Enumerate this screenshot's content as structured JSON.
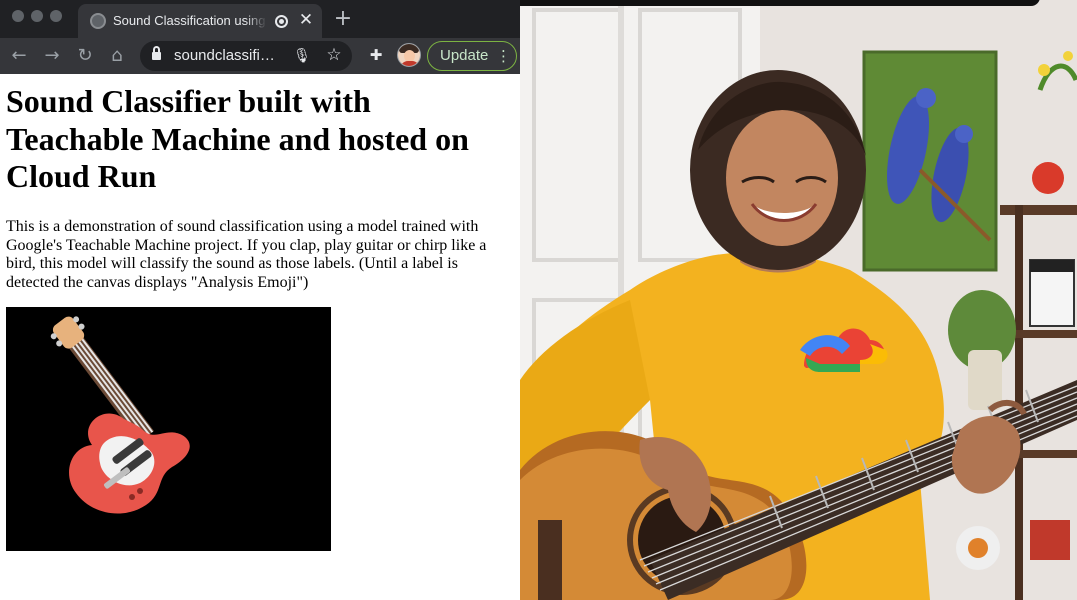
{
  "browser": {
    "tab": {
      "title": "Sound Classification using Teachable Machine",
      "close_icon": "close-icon",
      "recording_icon": "recording-icon"
    },
    "new_tab_icon": "plus-icon",
    "toolbar": {
      "back_icon": "arrow-left-icon",
      "forward_icon": "arrow-right-icon",
      "reload_icon": "reload-icon",
      "home_icon": "home-icon",
      "url": "soundclassifi…",
      "mic_icon": "microphone-icon",
      "bookmark_icon": "star-icon",
      "extensions_icon": "puzzle-icon",
      "update_label": "Update",
      "menu_icon": "kebab-menu-icon"
    }
  },
  "page": {
    "heading": "Sound Classifier built with Teachable Machine and hosted on Cloud Run",
    "description": "This is a demonstration of sound classification using a model trained with Google's Teachable Machine project. If you clap, play guitar or chirp like a bird, this model will classify the sound as those labels. (Until a label is detected the canvas displays \"Analysis Emoji\")",
    "canvas": {
      "emoji": "guitar-emoji",
      "background": "#000000"
    }
  },
  "video": {
    "subject": "presenter-playing-guitar",
    "shirt_color": "#f3b21f",
    "logo": "cloud-logo-icon"
  },
  "colors": {
    "tabbar": "#202124",
    "toolbar": "#35363a",
    "update_border": "#7cb342"
  }
}
